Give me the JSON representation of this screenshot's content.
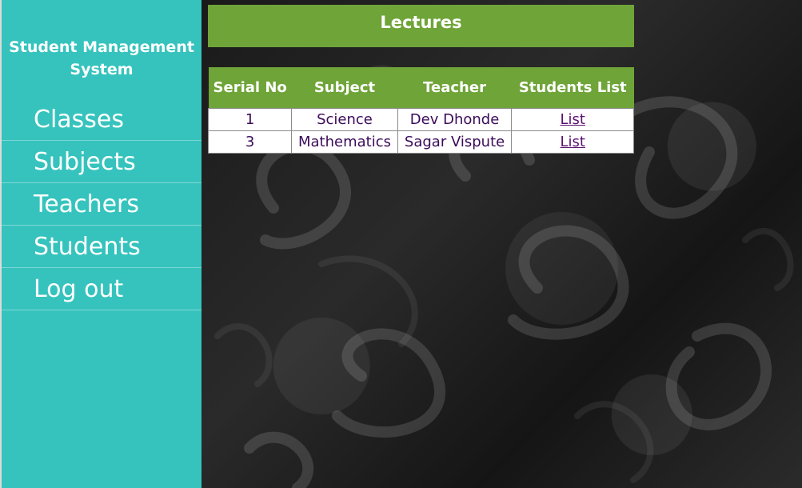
{
  "sidebar": {
    "brand": "Student Management System",
    "items": [
      {
        "label": "Classes"
      },
      {
        "label": "Subjects"
      },
      {
        "label": "Teachers"
      },
      {
        "label": "Students"
      },
      {
        "label": "Log out"
      }
    ]
  },
  "main": {
    "title": "Lectures",
    "table": {
      "headers": [
        "Serial No",
        "Subject",
        "Teacher",
        "Students List"
      ],
      "rows": [
        {
          "serial": "1",
          "subject": "Science",
          "teacher": "Dev Dhonde",
          "link": "List"
        },
        {
          "serial": "3",
          "subject": "Mathematics",
          "teacher": "Sagar Vispute",
          "link": "List"
        }
      ]
    }
  },
  "colors": {
    "sidebar": "#36c3bd",
    "accent_green": "#6fa438",
    "link": "#5b1170"
  }
}
